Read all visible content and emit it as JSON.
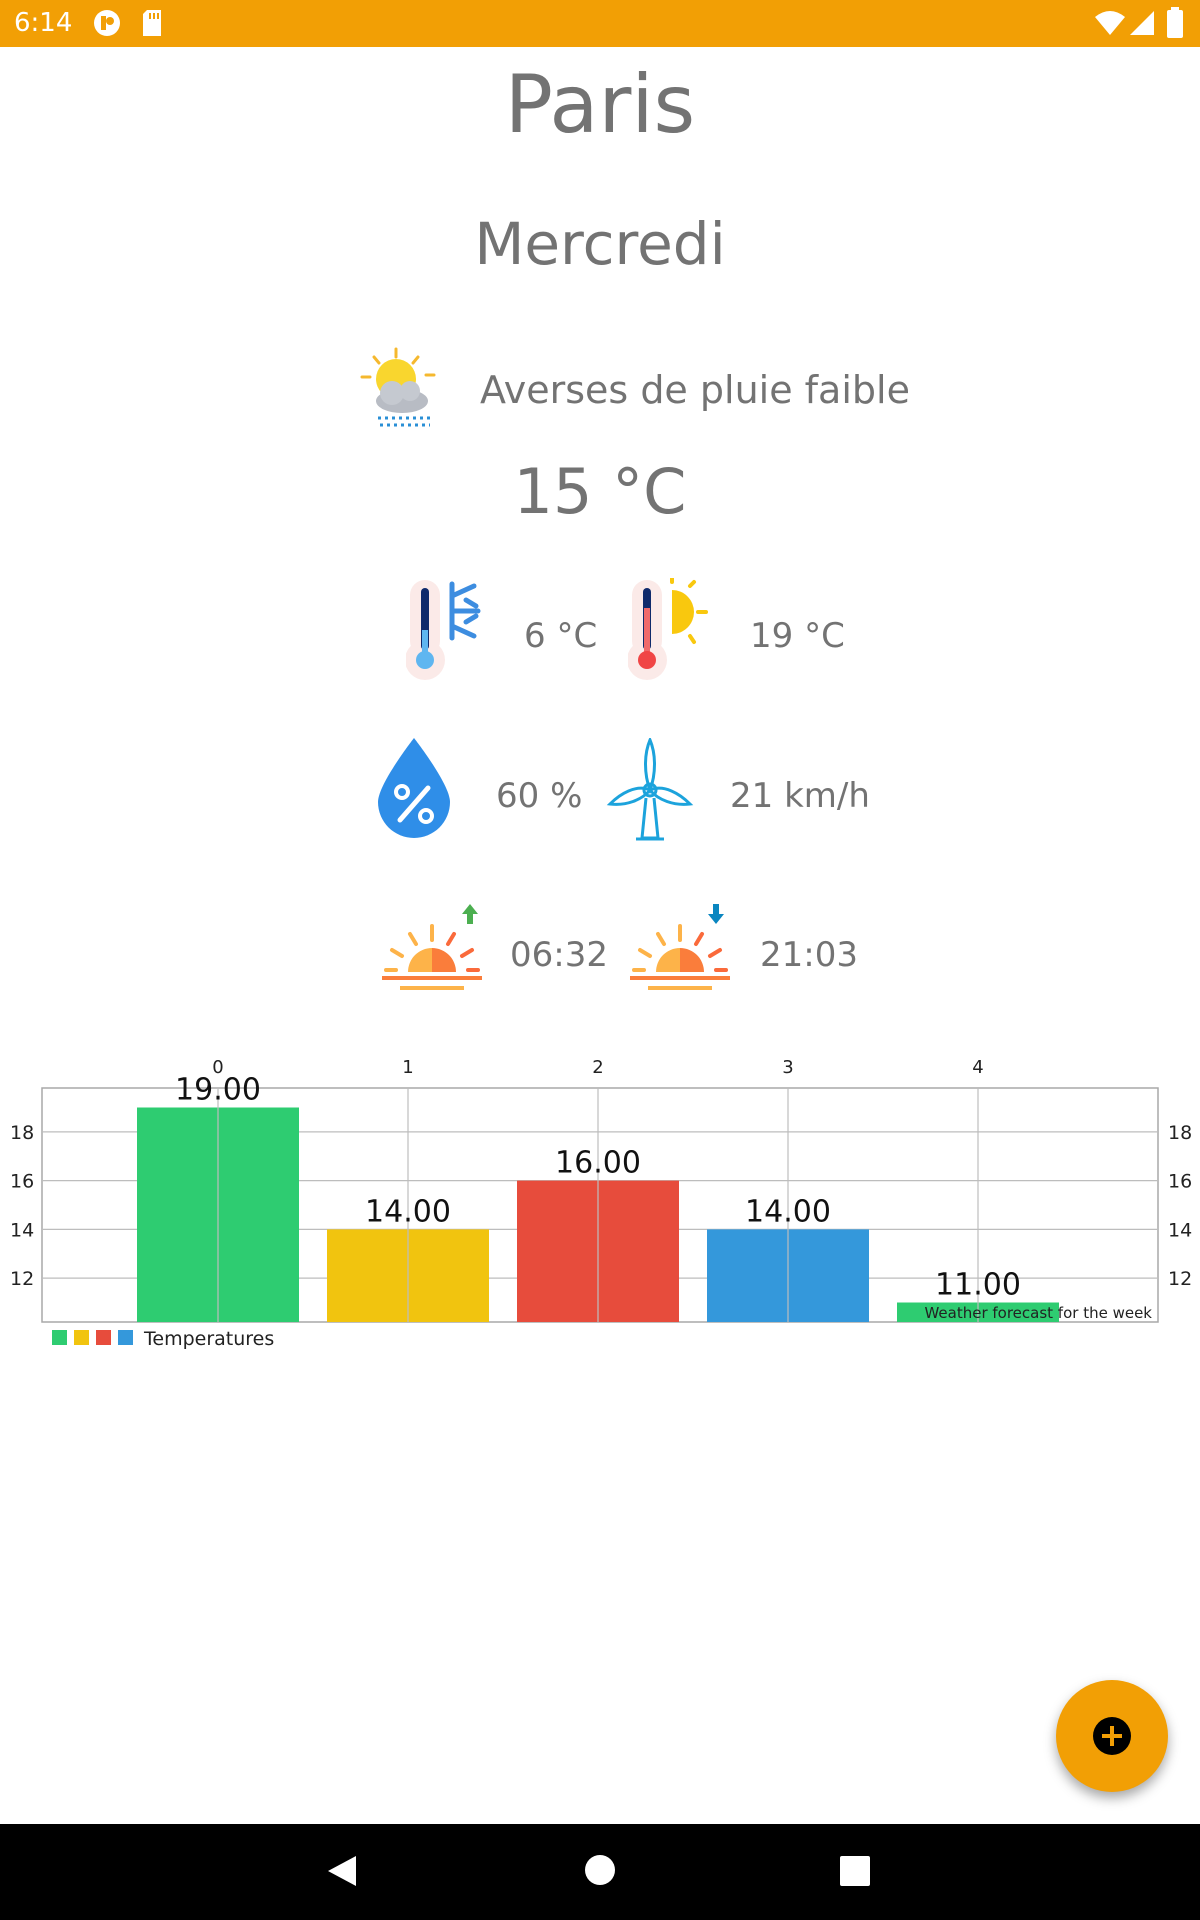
{
  "status_bar": {
    "time": "6:14"
  },
  "weather": {
    "city": "Paris",
    "day": "Mercredi",
    "description": "Averses de pluie faible",
    "temperature": "15 °C",
    "temp_min": "6 °C",
    "temp_max": "19 °C",
    "humidity": "60 %",
    "wind": "21 km/h",
    "sunrise": "06:32",
    "sunset": "21:03"
  },
  "icons": {
    "weather": "sun-cloud-rain-icon",
    "temp_min": "thermometer-snowflake-icon",
    "temp_max": "thermometer-sun-icon",
    "humidity": "humidity-drop-icon",
    "wind": "wind-turbine-icon",
    "sunrise": "sunrise-icon",
    "sunset": "sunset-icon",
    "fab": "add-icon"
  },
  "colors": {
    "accent": "#f29f05",
    "bar_colors": [
      "#2ecc71",
      "#f1c40f",
      "#e74c3c",
      "#3498db",
      "#2ecc71"
    ]
  },
  "chart_data": {
    "type": "bar",
    "categories": [
      "0",
      "1",
      "2",
      "3",
      "4"
    ],
    "values": [
      19,
      14,
      16,
      14,
      11
    ],
    "value_labels": [
      "19.00",
      "14.00",
      "16.00",
      "14.00",
      "11.00"
    ],
    "yticks": [
      "12",
      "14",
      "16",
      "18"
    ],
    "ylim": [
      10.2,
      19.8
    ],
    "legend": "Temperatures",
    "legend_placement": "bottom-left",
    "description": "Weather forecast for the week",
    "grid": true
  }
}
